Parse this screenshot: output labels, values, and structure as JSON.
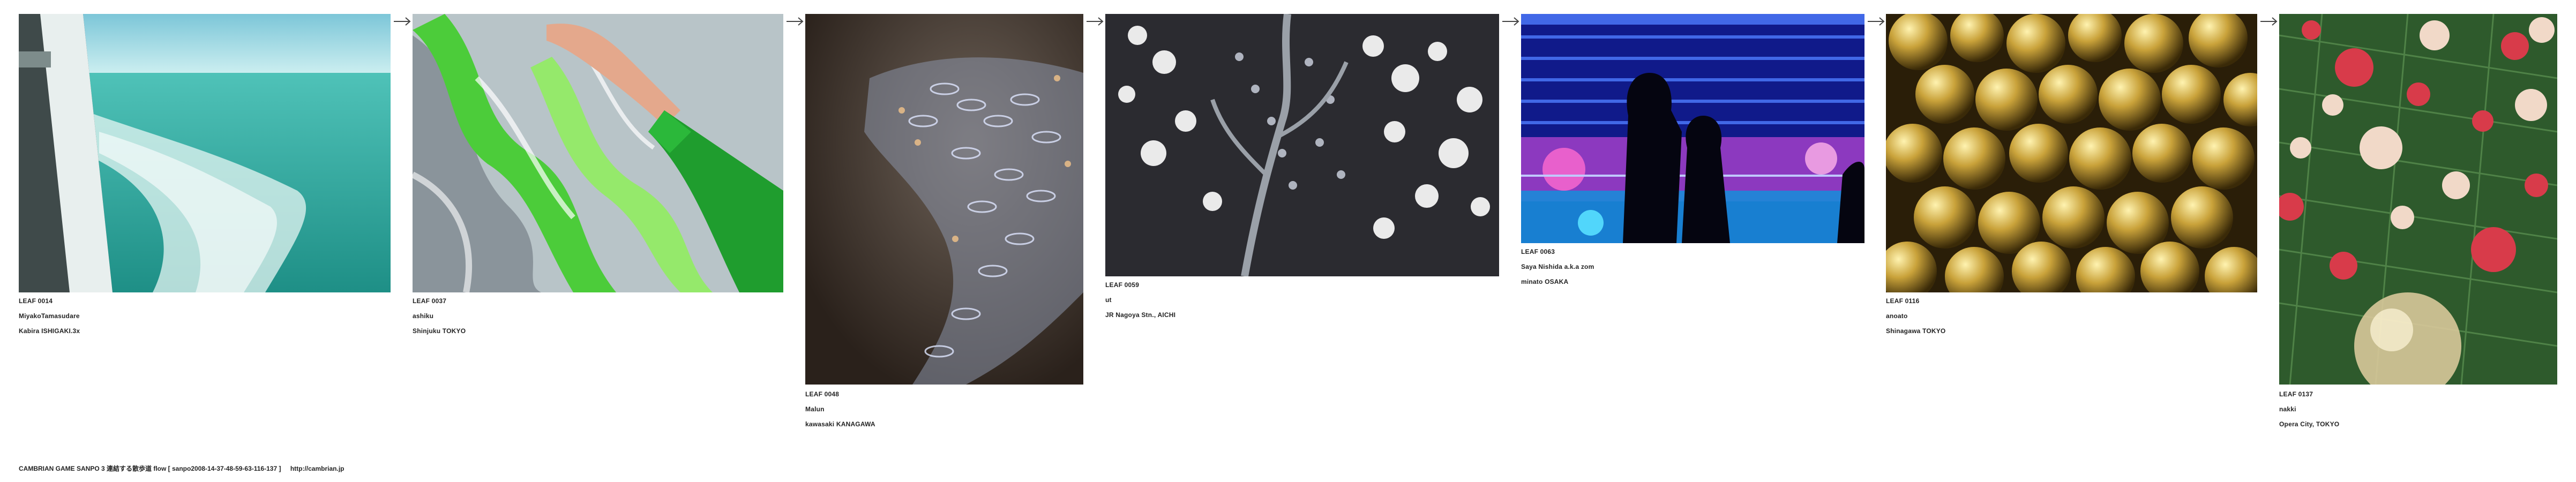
{
  "leaves": [
    {
      "id": "LEAF 0014",
      "title": "MiyakoTamasudare",
      "location": "Kabira ISHIGAKI.3x",
      "scene": "sea-wake"
    },
    {
      "id": "LEAF 0037",
      "title": "ashiku",
      "location": "Shinjuku TOKYO",
      "scene": "glass-hand"
    },
    {
      "id": "LEAF 0048",
      "title": "Malun",
      "location": "kawasaki KANAGAWA",
      "scene": "bokeh-swirl"
    },
    {
      "id": "LEAF 0059",
      "title": "ut",
      "location": "JR Nagoya Stn.,  AICHI",
      "scene": "white-lights"
    },
    {
      "id": "LEAF 0063",
      "title": "Saya Nishida a.k.a zom",
      "location": "minato OSAKA",
      "scene": "illumination-silhouettes"
    },
    {
      "id": "LEAF 0116",
      "title": "anoato",
      "location": "Shinagawa TOKYO",
      "scene": "gold-ornaments"
    },
    {
      "id": "LEAF 0137",
      "title": "nakki",
      "location": "Opera City, TOKYO",
      "scene": "christmas-tree"
    }
  ],
  "footer": {
    "title": "CAMBRIAN GAME  SANPO 3 連結する散歩道 flow [ sanpo2008-14-37-48-59-63-116-137 ]",
    "url": "http://cambrian.jp"
  },
  "colors": {
    "sea": "#2fa39a",
    "sky": "#bde3ea",
    "green": "#22b04a",
    "gold": "#c9a23a",
    "night_blue": "#1a2fd8",
    "magenta": "#e04ab0",
    "ornament_red": "#d83b4a"
  },
  "icons": {
    "flow_arrow": "right-arrow-icon"
  }
}
